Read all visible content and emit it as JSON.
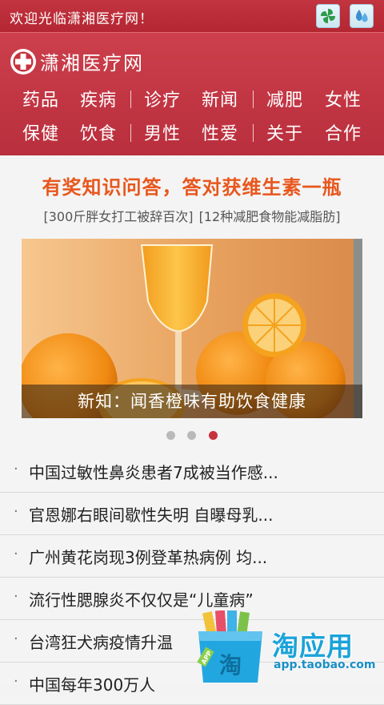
{
  "topbar": {
    "welcome_text": "欢迎光临潇湘医疗网！",
    "buttons": [
      {
        "icon": "pinwheel-icon"
      },
      {
        "icon": "water-drop-icon"
      }
    ]
  },
  "header": {
    "logo_text": "潇湘医疗网",
    "logo_icon": "medical-cross-icon",
    "accent_color": "#c13543",
    "nav_rows": [
      [
        "药品",
        "疾病",
        "诊疗",
        "新闻",
        "减肥",
        "女性"
      ],
      [
        "保健",
        "饮食",
        "男性",
        "性爱",
        "关于",
        "合作"
      ]
    ]
  },
  "main": {
    "headline": "有奖知识问答，答对获维生素一瓶",
    "sublinks": [
      "[300斤胖女打工被辞百次]",
      "[12种减肥食物能减脂肪]"
    ],
    "banner": {
      "caption": "新知：闻香橙味有助饮食健康",
      "image_subject": "orange-juice-and-oranges"
    },
    "carousel": {
      "total": 3,
      "active_index": 2
    },
    "news": [
      "中国过敏性鼻炎患者7成被当作感...",
      "官恩娜右眼间歇性失明 自曝母乳...",
      "广州黄花岗现3例登革热病例 均...",
      "流行性腮腺炎不仅仅是“儿童病”",
      "台湾狂犬病疫情升温",
      "中国每年300万人"
    ],
    "news_bullet": "·"
  },
  "watermark": {
    "brand": "淘应用",
    "url": "app.taobao.com",
    "bag_label": "淘",
    "bag_tag": "APP"
  }
}
